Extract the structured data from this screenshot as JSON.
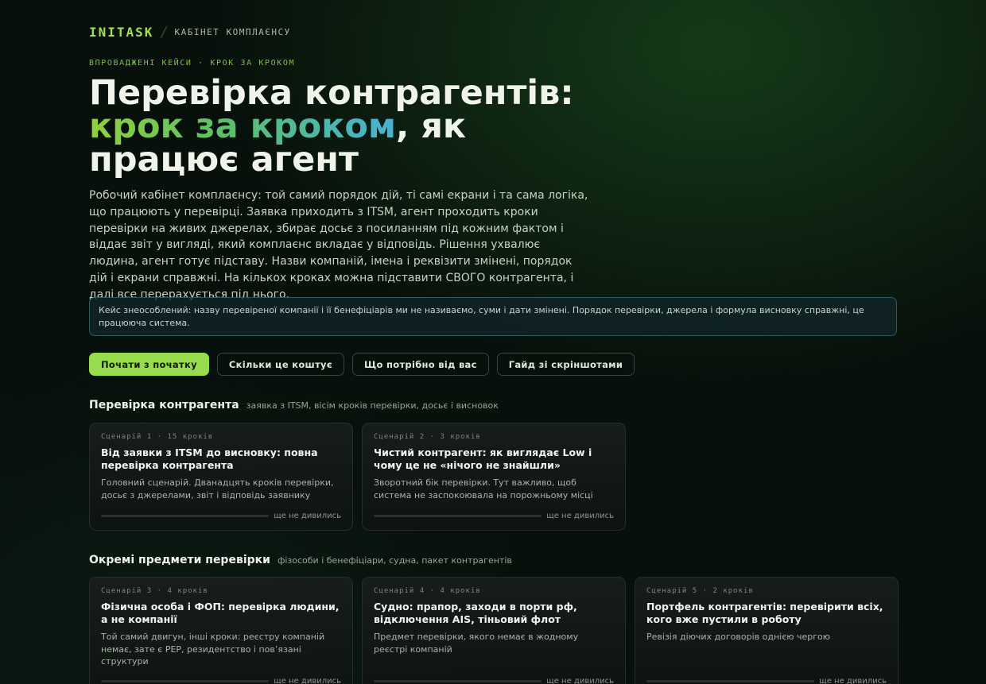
{
  "brand": {
    "name": "INITASK",
    "subtitle": "КАБІНЕТ КОМПЛАЄНСУ"
  },
  "hero": {
    "eyebrow": "ВПРОВАДЖЕНІ КЕЙСИ · КРОК ЗА КРОКОМ",
    "title_line1": "Перевірка контрагентів:",
    "title_highlight": "крок за кроком",
    "title_rest": ", як працює агент",
    "lede": "Робочий кабінет комплаєнсу: той самий порядок дій, ті самі екрани і та сама логіка, що працюють у перевірці. Заявка приходить з ITSM, агент проходить кроки перевірки на живих джерелах, збирає досьє з посиланням під кожним фактом і віддає звіт у вигляді, який комплаєнс вкладає у відповідь. Рішення ухвалює людина, агент готує підставу. Назви компаній, імена і реквізити змінені, порядок дій і екрани справжні. На кількох кроках можна підставити СВОГО контрагента, і далі все перерахується під нього."
  },
  "notice": "Кейс знеособлений: назву перевіреної компанії і її бенефіціарів ми не називаємо, суми і дати змінені. Порядок перевірки, джерела і формула висновку справжні, це працююча система.",
  "actions": {
    "start": "Почати з початку",
    "cost": "Скільки це коштує",
    "needs": "Що потрібно від вас",
    "guide": "Гайд зі скріншотами"
  },
  "sections": [
    {
      "title": "Перевірка контрагента",
      "subtitle": "заявка з ITSM, вісім кроків перевірки, досьє і висновок",
      "cards": [
        {
          "meta": "Сценарій 1 · 15 кроків",
          "title": "Від заявки з ITSM до висновку: повна перевірка контрагента",
          "desc": "Головний сценарій. Дванадцять кроків перевірки, досьє з джерелами, звіт і відповідь заявнику",
          "status": "ще не дивились",
          "progress": 0
        },
        {
          "meta": "Сценарій 2 · 3 кроків",
          "title": "Чистий контрагент: як виглядає Low і чому це не «нічого не знайшли»",
          "desc": "Зворотний бік перевірки. Тут важливо, щоб система не заспокоювала на порожньому місці",
          "status": "ще не дивились",
          "progress": 0
        }
      ]
    },
    {
      "title": "Окремі предмети перевірки",
      "subtitle": "фізособи і бенефіціари, судна, пакет контрагентів",
      "cards": [
        {
          "meta": "Сценарій 3 · 4 кроків",
          "title": "Фізична особа і ФОП: перевірка людини, а не компанії",
          "desc": "Той самий двигун, інші кроки: реєстру компаній немає, зате є PEP, резидентство і пов’язані структури",
          "status": "ще не дивились",
          "progress": 0
        },
        {
          "meta": "Сценарій 4 · 4 кроків",
          "title": "Судно: прапор, заходи в порти рф, відключення AIS, тіньовий флот",
          "desc": "Предмет перевірки, якого немає в жодному реєстрі компаній",
          "status": "ще не дивились",
          "progress": 0
        },
        {
          "meta": "Сценарій 5 · 2 кроків",
          "title": "Портфель контрагентів: перевірити всіх, кого вже пустили в роботу",
          "desc": "Ревізія діючих договорів однією чергою",
          "status": "ще не дивились",
          "progress": 0
        }
      ]
    }
  ]
}
